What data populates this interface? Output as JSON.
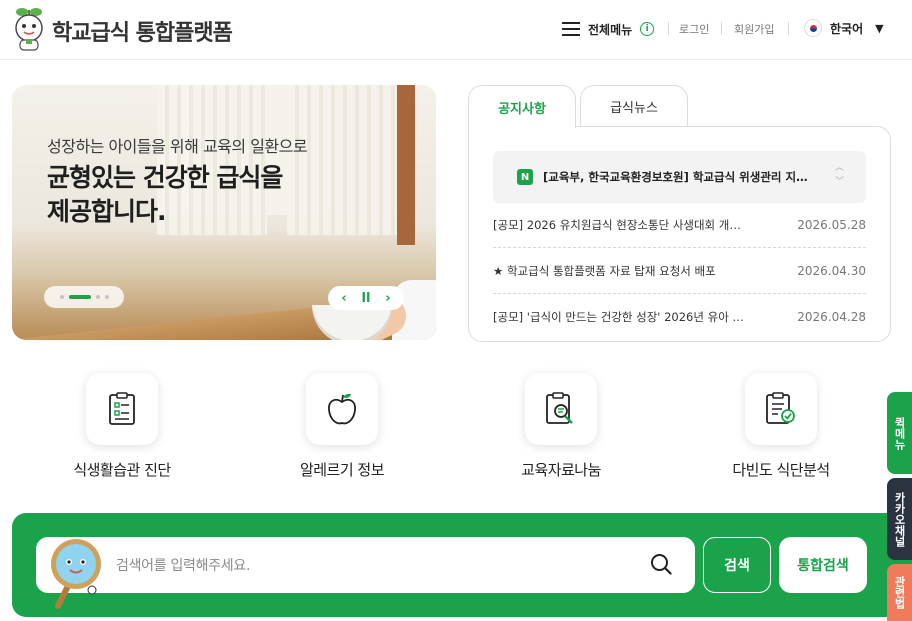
{
  "header": {
    "site_title": "학교급식 통합플랫폼",
    "menu_label": "전체메뉴",
    "info_icon": "info-icon",
    "login": "로그인",
    "signup": "회원가입",
    "language": "한국어"
  },
  "banner": {
    "subtitle": "성장하는 아이들을 위해 교육의 일환으로",
    "title": "균형있는 건강한 급식을\n제공합니다.",
    "prev": "‹",
    "pause": "ll",
    "next": "›"
  },
  "notice": {
    "tabs": [
      "공지사항",
      "급식뉴스"
    ],
    "headline": {
      "badge": "N",
      "text": "[교육부, 한국교육환경보호원] 학교급식 위생관리 지…"
    },
    "items": [
      {
        "title": "[공모] 2026 유치원급식 현장소통단 사생대회 개…",
        "date": "2026.05.28"
      },
      {
        "title": "★ 학교급식 통합플랫폼 자료 탑재 요청서 배포",
        "date": "2026.04.30"
      },
      {
        "title": "[공모] '급식이 만드는 건강한 성장' 2026년 유아 …",
        "date": "2026.04.28"
      }
    ]
  },
  "quick_menu": [
    {
      "label": "식생활습관 진단",
      "icon": "checklist-icon"
    },
    {
      "label": "알레르기 정보",
      "icon": "apple-icon"
    },
    {
      "label": "교육자료나눔",
      "icon": "clipboard-search-icon"
    },
    {
      "label": "다빈도 식단분석",
      "icon": "clipboard-check-icon"
    }
  ],
  "search": {
    "placeholder": "검색어를 입력해주세요.",
    "search_button": "검색",
    "total_search_button": "통합검색"
  },
  "side_tabs": [
    {
      "label": "퀵메뉴",
      "color": "#1aa34a"
    },
    {
      "label": "카카오채널",
      "color": "#2b3340"
    },
    {
      "label": "관련법",
      "color": "#f07a5a"
    }
  ],
  "colors": {
    "accent": "#1aa34a"
  }
}
